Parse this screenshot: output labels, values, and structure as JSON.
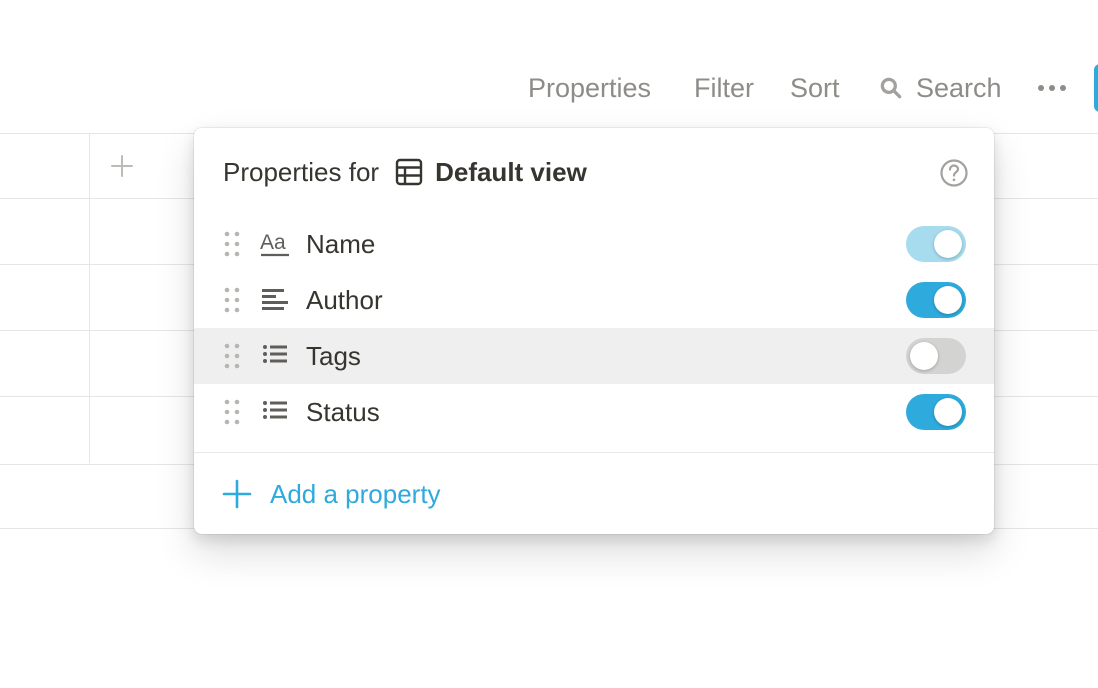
{
  "colors": {
    "accent": "#2eaadc",
    "toggle_disabled": "#a7dcef",
    "toggle_off": "#d3d3d1",
    "muted_text": "#8e8c88",
    "hover_row": "#efefef"
  },
  "toolbar": {
    "properties_label": "Properties",
    "filter_label": "Filter",
    "sort_label": "Sort",
    "search_label": "Search",
    "search_icon": "search-icon",
    "more_icon": "more-horizontal-icon"
  },
  "popover": {
    "title_prefix": "Properties for",
    "view_icon": "table-icon",
    "view_name": "Default view",
    "help_icon": "help-circle-icon",
    "properties": [
      {
        "label": "Name",
        "icon": "text-aa-icon",
        "state": "on-disabled"
      },
      {
        "label": "Author",
        "icon": "text-lines-icon",
        "state": "on"
      },
      {
        "label": "Tags",
        "icon": "list-icon",
        "state": "off"
      },
      {
        "label": "Status",
        "icon": "list-icon",
        "state": "on"
      }
    ],
    "add_label": "Add a property",
    "add_icon": "plus-icon"
  }
}
